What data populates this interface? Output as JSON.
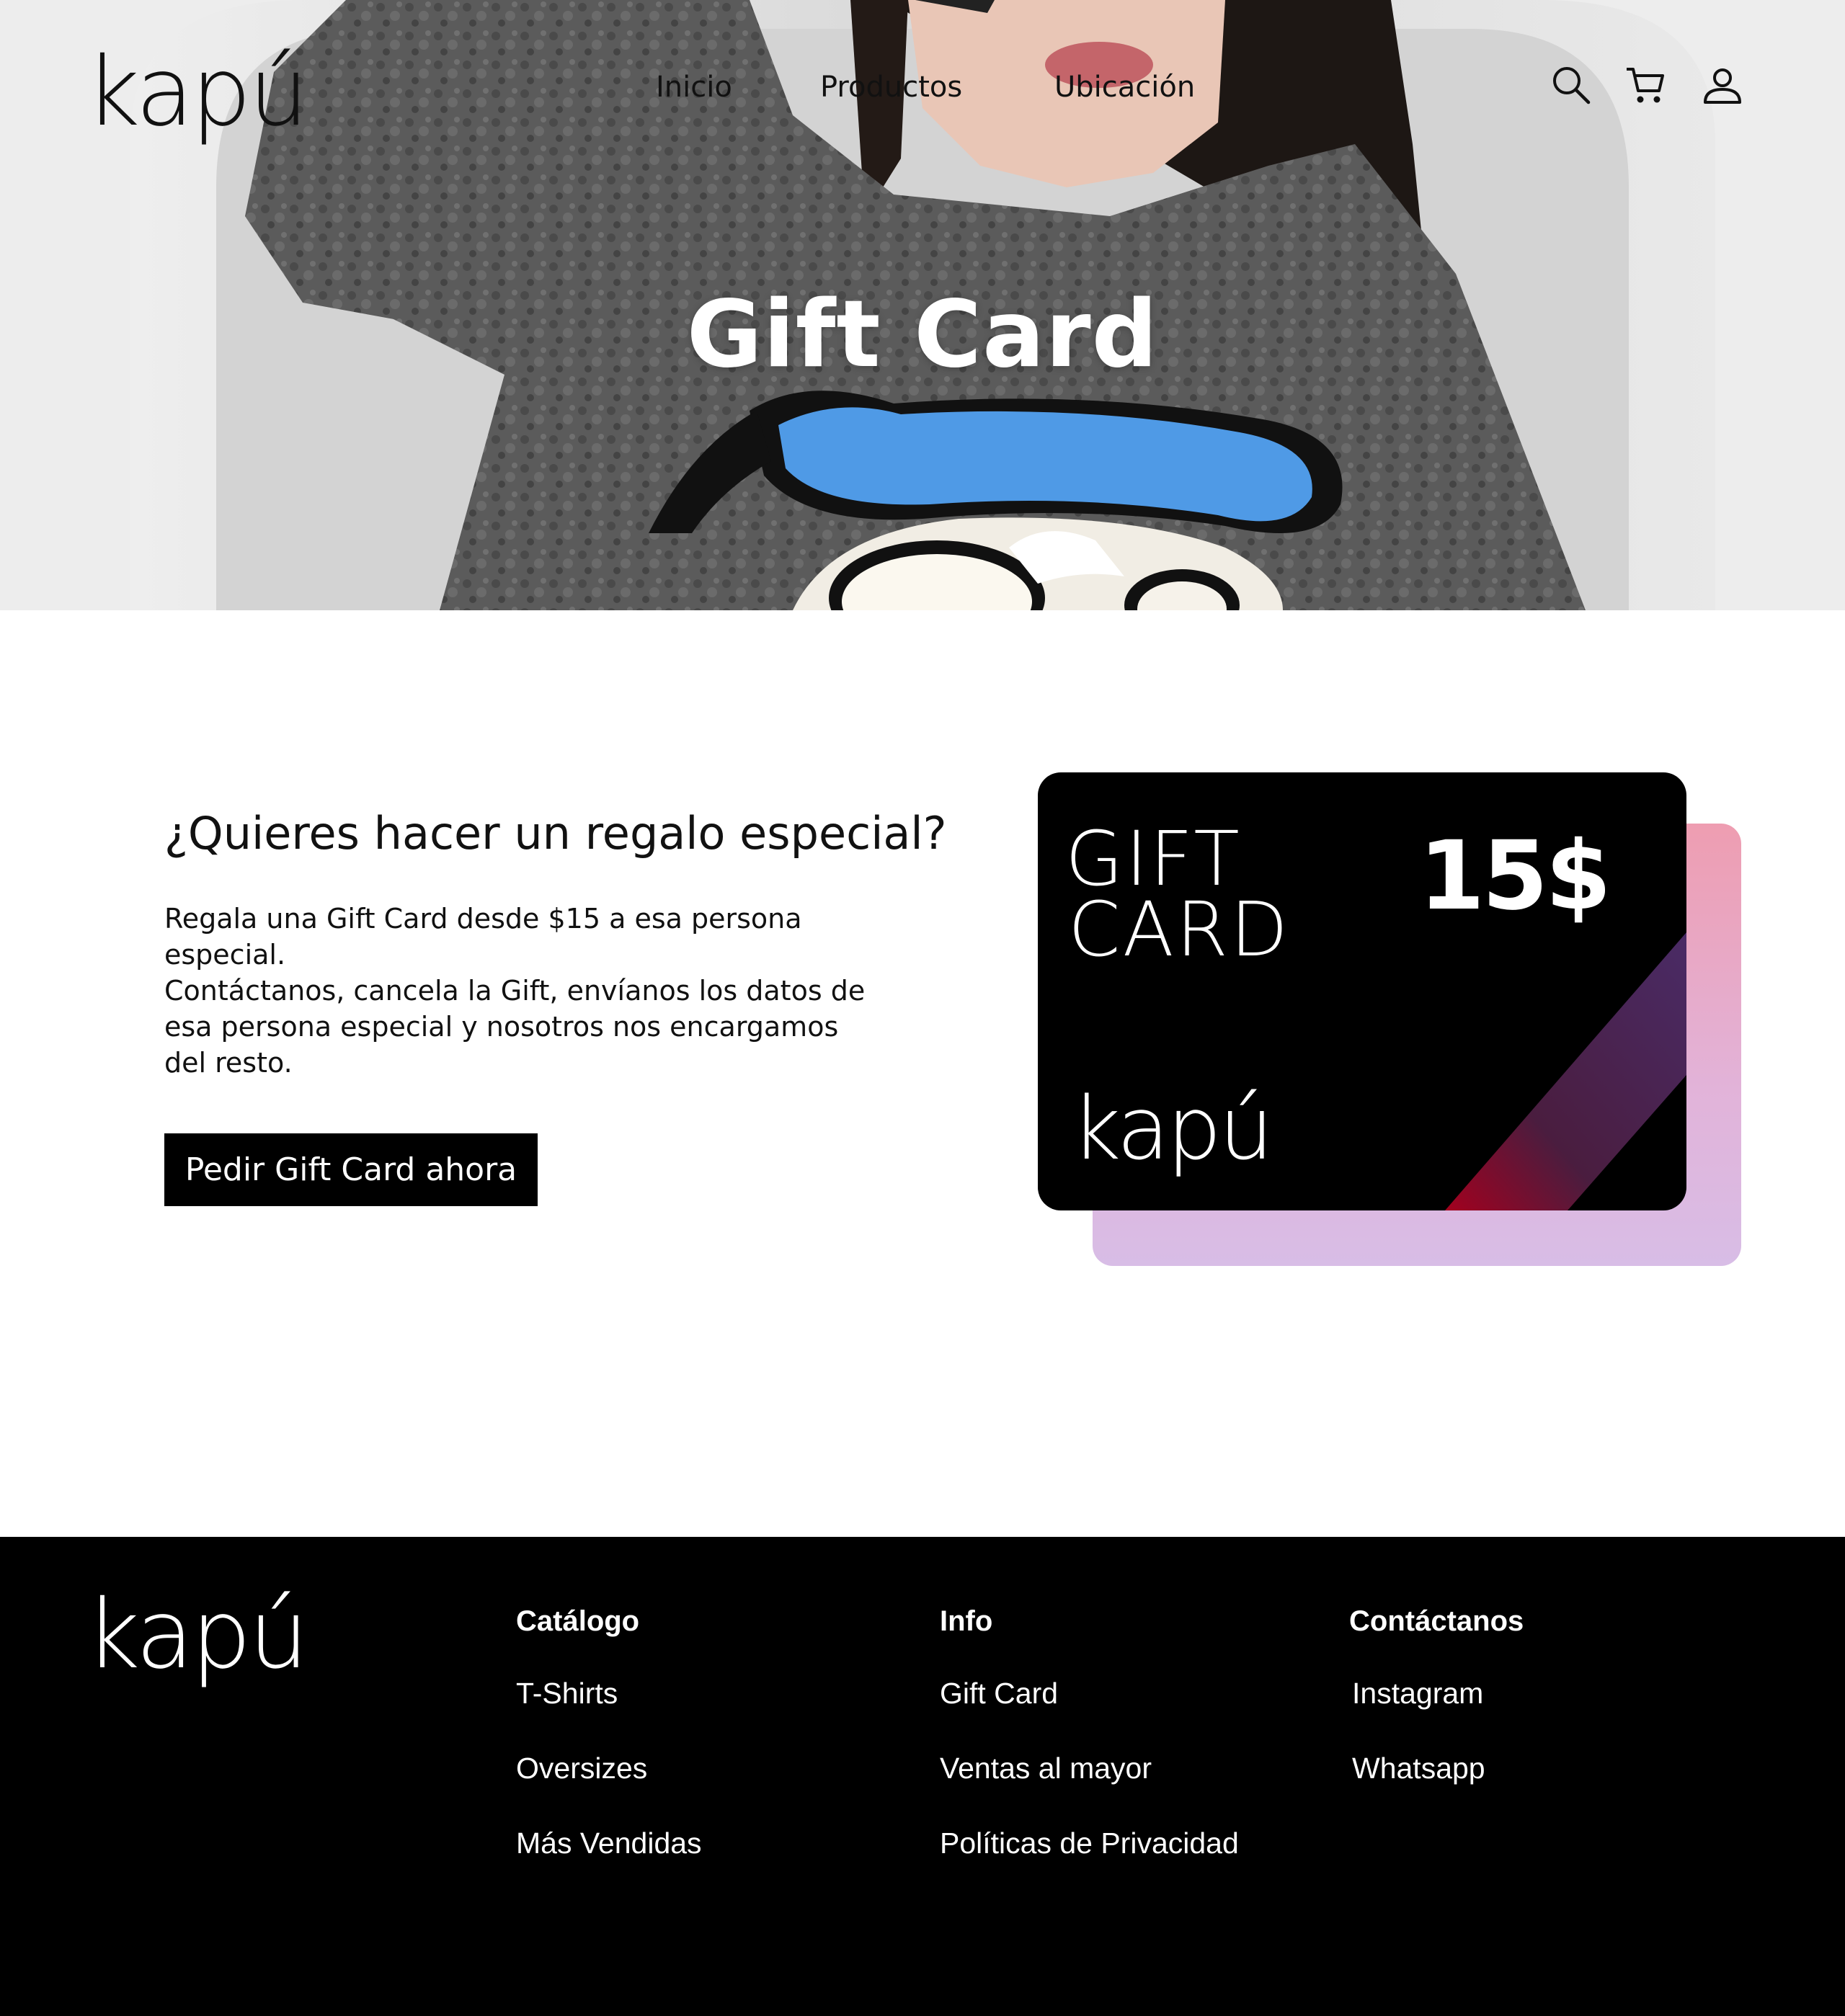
{
  "header": {
    "logo": "kapú",
    "nav": [
      {
        "label": "Inicio"
      },
      {
        "label": "Productos"
      },
      {
        "label": "Ubicación"
      }
    ],
    "icons": [
      "search-icon",
      "cart-icon",
      "user-icon"
    ]
  },
  "hero": {
    "title": "Gift Card"
  },
  "main": {
    "heading": "¿Quieres hacer un regalo especial?",
    "paragraph_1": "Regala una Gift Card desde $15 a esa persona especial.",
    "paragraph_2": "Contáctanos, cancela la Gift, envíanos los datos de esa persona especial y nosotros nos encargamos del resto.",
    "cta_label": "Pedir Gift Card ahora"
  },
  "gift_card": {
    "word_1": "GIFT",
    "word_2": "CARD",
    "amount": "15$",
    "logo": "kapú"
  },
  "footer": {
    "logo": "kapú",
    "columns": [
      {
        "title": "Catálogo",
        "links": [
          "T-Shirts",
          "Oversizes",
          "Más Vendidas"
        ]
      },
      {
        "title": "Info",
        "links": [
          "Gift Card",
          "Ventas al mayor",
          "Políticas de Privacidad"
        ]
      },
      {
        "title": "Contáctanos",
        "links": [
          "Instagram",
          "Whatsapp"
        ]
      }
    ]
  },
  "colors": {
    "footer_bg": "#000000",
    "cta_bg": "#000000",
    "card_back_top": "#ee9db1",
    "card_back_bottom": "#d8bde6",
    "shirt_gray": "#5a5a5a",
    "hat_blue": "#4f9ae6"
  }
}
